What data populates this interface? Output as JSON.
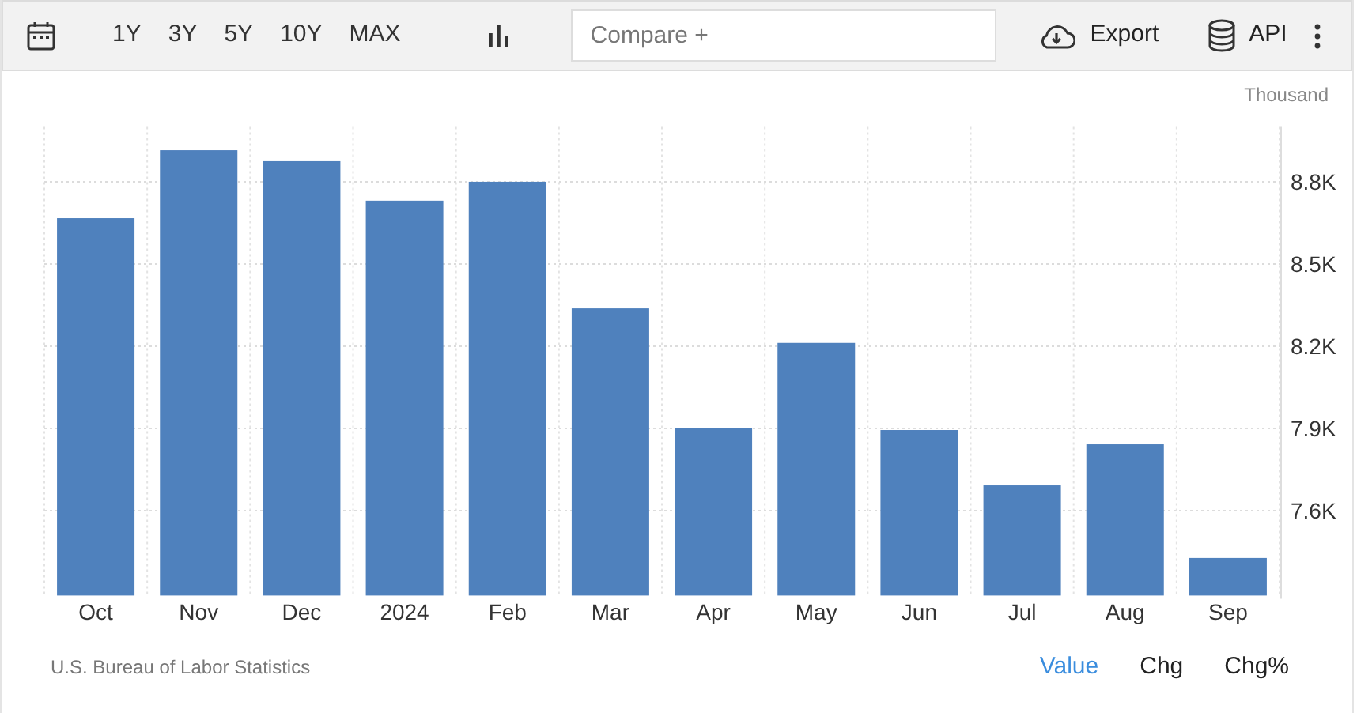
{
  "toolbar": {
    "ranges": [
      "1Y",
      "3Y",
      "5Y",
      "10Y",
      "MAX"
    ],
    "compare": {
      "placeholder": "Compare +"
    },
    "actions": [
      {
        "kind": "export",
        "label": "Export"
      },
      {
        "kind": "api",
        "label": "API"
      }
    ]
  },
  "unit": "Thousand",
  "chart_data": {
    "type": "bar",
    "categories": [
      "Oct",
      "Nov",
      "Dec",
      "2024",
      "Feb",
      "Mar",
      "Apr",
      "May",
      "Jun",
      "Jul",
      "Aug",
      "Sep"
    ],
    "grid": true,
    "series": [
      {
        "color": "#4f81bd",
        "values": [
          8667,
          8915,
          8875,
          8731,
          8800,
          8338,
          7900,
          8212,
          7894,
          7692,
          7842,
          7427
        ]
      }
    ],
    "ylim": [
      7290,
      9000
    ],
    "yticks": [
      {
        "value": 7600,
        "label": "7.6K"
      },
      {
        "value": 7900,
        "label": "7.9K"
      },
      {
        "value": 8200,
        "label": "8.2K"
      },
      {
        "value": 8500,
        "label": "8.5K"
      },
      {
        "value": 8800,
        "label": "8.8K"
      }
    ]
  },
  "source": "U.S. Bureau of Labor Statistics",
  "view_modes": [
    {
      "label": "Value",
      "selected": true
    },
    {
      "label": "Chg",
      "selected": false
    },
    {
      "label": "Chg%",
      "selected": false
    }
  ]
}
